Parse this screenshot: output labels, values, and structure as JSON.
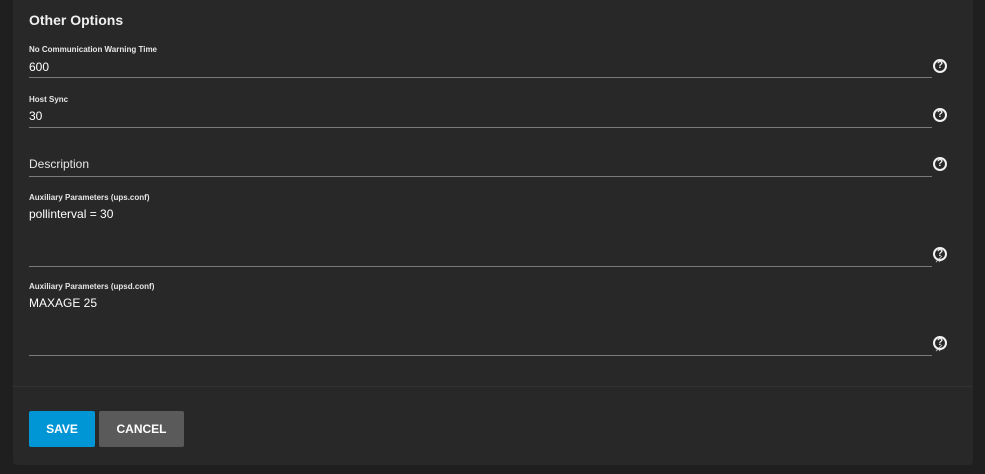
{
  "section": {
    "title": "Other Options"
  },
  "fields": {
    "no_comm_warning": {
      "label": "No Communication Warning Time",
      "value": "600"
    },
    "host_sync": {
      "label": "Host Sync",
      "value": "30"
    },
    "description": {
      "placeholder": "Description",
      "value": ""
    },
    "aux_ups": {
      "label": "Auxiliary Parameters (ups.conf)",
      "value": "pollinterval = 30"
    },
    "aux_upsd": {
      "label": "Auxiliary Parameters (upsd.conf)",
      "value": "MAXAGE 25"
    }
  },
  "help_icon_glyph": "?",
  "actions": {
    "save_label": "SAVE",
    "cancel_label": "CANCEL"
  },
  "colors": {
    "background": "#1f1f1f",
    "card": "#282828",
    "primary": "#0095d5",
    "secondary": "#5a5a5a"
  }
}
